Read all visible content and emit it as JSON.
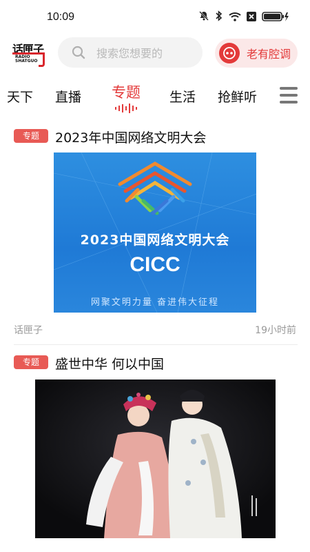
{
  "status_bar": {
    "time": "10:09"
  },
  "header": {
    "logo": {
      "name": "话匣子",
      "subtitle_line1": "RADIO",
      "subtitle_line2": "SHATGUO"
    },
    "search_placeholder": "搜索您想要的",
    "tag_button_label": "老有腔调"
  },
  "nav": {
    "tabs": [
      {
        "label": "天下",
        "active": false
      },
      {
        "label": "直播",
        "active": false
      },
      {
        "label": "专题",
        "active": true
      },
      {
        "label": "生活",
        "active": false
      },
      {
        "label": "抢鲜听",
        "active": false
      }
    ]
  },
  "feed": [
    {
      "badge": "专题",
      "title": "2023年中国网络文明大会",
      "image": {
        "headline": "2023中国网络文明大会",
        "acronym": "CICC",
        "slogan": "网聚文明力量  奋进伟大征程"
      },
      "source": "话匣子",
      "time": "19小时前"
    },
    {
      "badge": "专题",
      "title": "盛世中华 何以中国",
      "image": {
        "caption": ""
      }
    }
  ],
  "colors": {
    "accent": "#e33a3a",
    "badge": "#e85a55"
  }
}
